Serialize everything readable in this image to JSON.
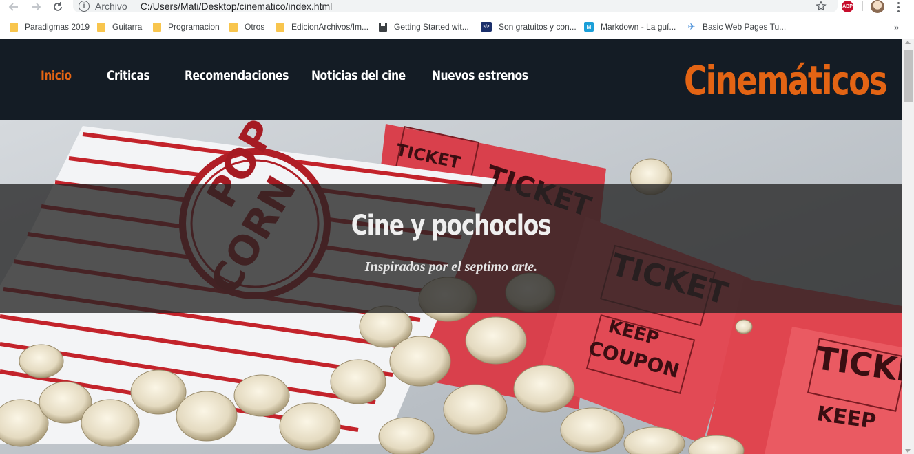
{
  "browser": {
    "url_scheme": "Archivo",
    "url_path": "C:/Users/Mati/Desktop/cinematico/index.html",
    "extension_label": "ABP",
    "bookmarks": [
      {
        "label": "Paradigmas 2019",
        "icon": "folder-icon"
      },
      {
        "label": "Guitarra",
        "icon": "folder-icon"
      },
      {
        "label": "Programacion",
        "icon": "folder-icon"
      },
      {
        "label": "Otros",
        "icon": "folder-icon"
      },
      {
        "label": "EdicionArchivos/Im...",
        "icon": "folder-icon"
      },
      {
        "label": "Getting Started wit...",
        "icon": "save-disk-icon"
      },
      {
        "label": "Son gratuitos y con...",
        "icon": "cs-site-icon",
        "icon_text": "</>"
      },
      {
        "label": "Markdown - La guí...",
        "icon": "markdown-site-icon",
        "icon_text": "M"
      },
      {
        "label": "Basic Web Pages Tu...",
        "icon": "plane-icon",
        "icon_text": "✈"
      }
    ],
    "bookmarks_overflow": "»"
  },
  "site": {
    "nav": [
      {
        "label": "Inicio",
        "active": true
      },
      {
        "label": "Criticas",
        "active": false
      },
      {
        "label": "Recomendaciones",
        "active": false
      },
      {
        "label": "Noticias del cine",
        "active": false
      },
      {
        "label": "Nuevos estrenos",
        "active": false
      }
    ],
    "brand": "Cinemáticos",
    "hero": {
      "title": "Cine y pochoclos",
      "subtitle": "Inspirados por el septimo arte."
    },
    "colors": {
      "accent": "#e36414",
      "header_bg": "#141c25",
      "band": "#242424"
    }
  }
}
